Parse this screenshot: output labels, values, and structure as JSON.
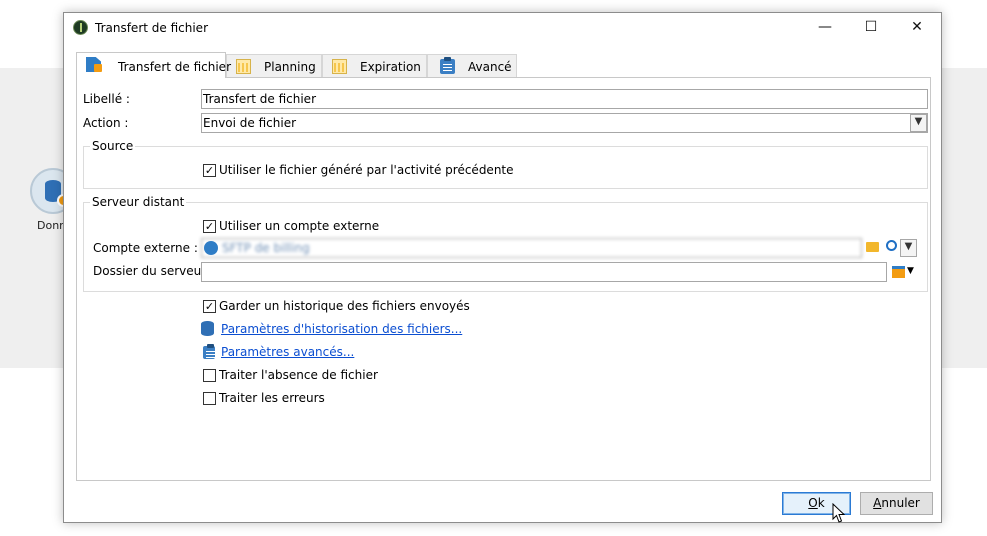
{
  "background": {
    "node_label": "Donn",
    "accent_color": "#2f6fb5"
  },
  "window": {
    "title": "Transfert de fichier",
    "controls": {
      "minimize": "—",
      "maximize": "☐",
      "close": "✕"
    }
  },
  "tabs": [
    {
      "label": "Transfert de fichier",
      "icon": "file-upload-icon",
      "active": true
    },
    {
      "label": "Planning",
      "icon": "calendar-icon",
      "active": false
    },
    {
      "label": "Expiration",
      "icon": "calendar-icon",
      "active": false
    },
    {
      "label": "Avancé",
      "icon": "clipboard-icon",
      "active": false
    }
  ],
  "form": {
    "libelle": {
      "label": "Libellé :",
      "value": "Transfert de fichier"
    },
    "action": {
      "label": "Action :",
      "value": "Envoi de fichier"
    },
    "source": {
      "title": "Source",
      "use_generated_file": {
        "label": "Utiliser le fichier généré par l'activité précédente",
        "checked": true
      }
    },
    "remote_server": {
      "title": "Serveur distant",
      "use_external_account": {
        "label": "Utiliser un compte externe",
        "checked": true
      },
      "external_account": {
        "label": "Compte externe :",
        "value": "SFTP de billing"
      },
      "server_folder": {
        "label": "Dossier du serveur :",
        "value": ""
      }
    },
    "keep_history": {
      "label": "Garder un historique des fichiers envoyés",
      "checked": true
    },
    "history_settings_link": "Paramètres d'historisation des fichiers...",
    "advanced_settings_link": "Paramètres avancés...",
    "handle_missing_file": {
      "label": "Traiter l'absence de fichier",
      "checked": false
    },
    "handle_errors": {
      "label": "Traiter les erreurs",
      "checked": false
    }
  },
  "buttons": {
    "ok": {
      "accel": "O",
      "rest": "k"
    },
    "cancel": {
      "accel": "A",
      "rest": "nnuler"
    }
  },
  "check_mark": "✓"
}
